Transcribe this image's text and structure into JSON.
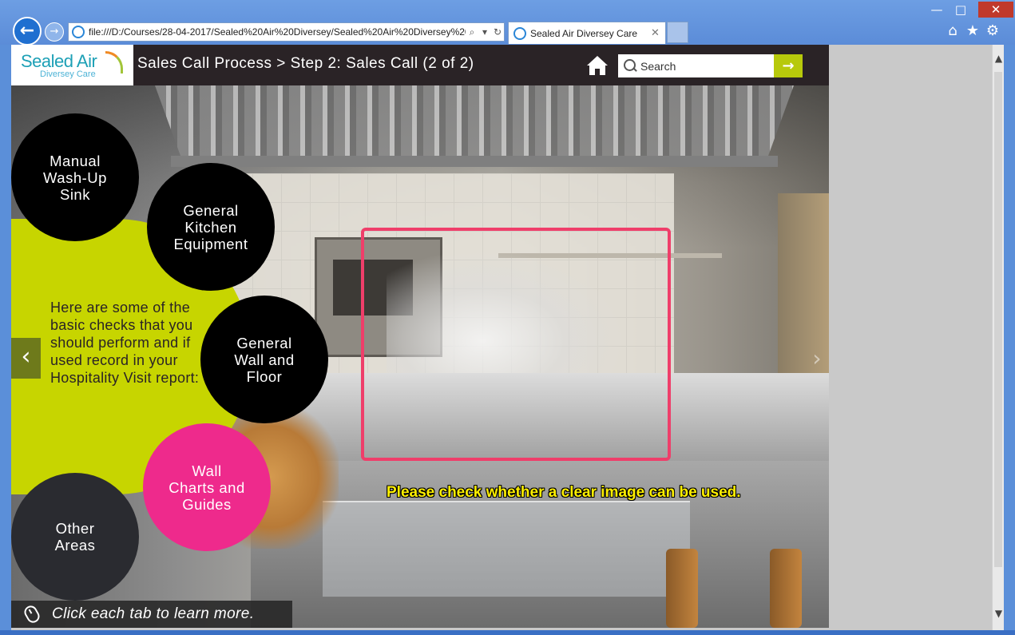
{
  "window": {
    "minimize": "—",
    "maximize": "□",
    "close": "✕"
  },
  "browser": {
    "back_icon": "arrow-left-icon",
    "forward_icon": "arrow-right-icon",
    "address": "file:///D:/Courses/28-04-2017/Sealed%20Air%20Diversey/Sealed%20Air%20Diversey%20C",
    "tab_title": "Sealed Air Diversey Care",
    "icons": [
      "home-icon",
      "star-icon",
      "gear-icon"
    ]
  },
  "course": {
    "logo_brand": "Sealed Air",
    "logo_sub": "Diversey Care",
    "title": "Sales Call Process > Step 2: Sales Call (2 of 2)",
    "search_placeholder": "Search",
    "search_go": "→",
    "intro": "Here are some of the basic checks that you should perform and if used record in your Hospitality Visit report:",
    "circles": [
      {
        "label": "Manual\nWash-Up\nSink"
      },
      {
        "label": "General\nKitchen\nEquipment"
      },
      {
        "label": "General\nWall and\nFloor"
      },
      {
        "label": "Wall\nCharts and\nGuides"
      },
      {
        "label": "Other\nAreas"
      }
    ],
    "caption": "Please check whether a clear image can be used.",
    "instruction": "Click each tab to learn more.",
    "prev": "‹",
    "next": "›"
  },
  "colors": {
    "accent_green": "#c7d500",
    "accent_pink": "#ee2a8c",
    "highlight": "#ef3e6a",
    "caption_yellow": "#fff000",
    "header_dark": "#2a2326"
  }
}
